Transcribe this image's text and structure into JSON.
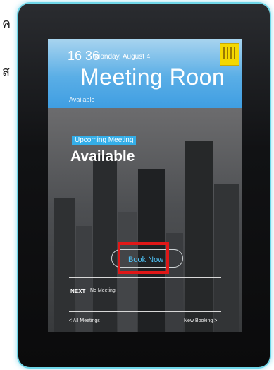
{
  "side_text": {
    "line1": "ค",
    "line2": "ส"
  },
  "header": {
    "time": "16 36",
    "date": "Monday, August 4",
    "room_title": "Meeting Roon",
    "status": "Available"
  },
  "main": {
    "upcoming_label": "Upcoming Meeting",
    "status": "Available",
    "book_button": "Book Now"
  },
  "next": {
    "label": "NEXT",
    "value": "No Meeting"
  },
  "footer": {
    "all_meetings": "< All Meetings",
    "new_booking": "New Booking >"
  },
  "colors": {
    "header_gradient_top": "#a8d4ef",
    "header_gradient_bottom": "#3f9ee2",
    "badge": "#34aee8",
    "book_label": "#4fc3f7",
    "highlight_box": "#e01818",
    "calendar_icon": "#f4d800",
    "frame_glow": "#6fd6e8"
  },
  "icons": {
    "calendar": "calendar-icon"
  }
}
